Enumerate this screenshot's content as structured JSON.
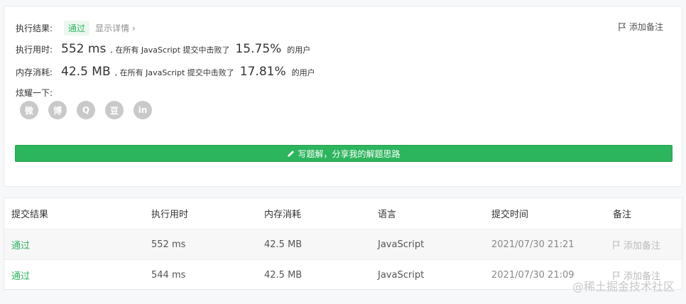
{
  "result": {
    "status_label": "执行结果:",
    "status_value": "通过",
    "detail_link": "显示详情 ›",
    "add_note": "添加备注",
    "runtime": {
      "label": "执行用时:",
      "value": "552 ms",
      "middle": ", 在所有 JavaScript 提交中击败了",
      "percent": "15.75%",
      "suffix": "的用户"
    },
    "memory": {
      "label": "内存消耗:",
      "value": "42.5 MB",
      "middle": ", 在所有 JavaScript 提交中击败了",
      "percent": "17.81%",
      "suffix": "的用户"
    },
    "share_label": "炫耀一下:",
    "share_icons": [
      "wechat-icon",
      "weibo-icon",
      "qq-icon",
      "douban-icon",
      "linkedin-icon"
    ],
    "share_glyphs": [
      "微",
      "博",
      "Q",
      "豆",
      "in"
    ],
    "write_button": "写题解，分享我的解题思路"
  },
  "table": {
    "headers": [
      "提交结果",
      "执行用时",
      "内存消耗",
      "语言",
      "提交时间",
      "备注"
    ],
    "rows": [
      {
        "result": "通过",
        "time": "552 ms",
        "memory": "42.5 MB",
        "lang": "JavaScript",
        "submitted": "2021/07/30 21:21",
        "note": "添加备注"
      },
      {
        "result": "通过",
        "time": "544 ms",
        "memory": "42.5 MB",
        "lang": "JavaScript",
        "submitted": "2021/07/30 21:09",
        "note": "添加备注"
      }
    ]
  },
  "watermark": "@稀土掘金技术社区",
  "colors": {
    "accent": "#2db55d",
    "icon_gray": "#c9c9c9"
  }
}
